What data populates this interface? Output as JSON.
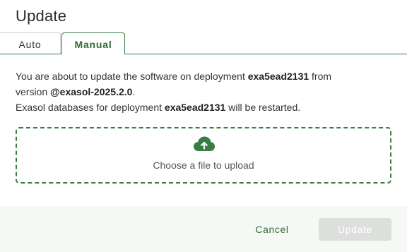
{
  "dialog": {
    "title": "Update"
  },
  "tabs": [
    {
      "label": "Auto",
      "active": false
    },
    {
      "label": "Manual",
      "active": true
    }
  ],
  "message": {
    "line1_pre": "You are about to update the software on deployment ",
    "deployment": "exa5ead2131",
    "line1_post": " from",
    "line2_pre": "version ",
    "version": "@exasol-2025.2.0",
    "line2_post": ".",
    "line3_pre": "Exasol databases for deployment ",
    "deployment_again": "exa5ead2131",
    "line3_post": " will be restarted."
  },
  "dropzone": {
    "icon": "cloud-upload-icon",
    "label": "Choose a file to upload"
  },
  "footer": {
    "cancel_label": "Cancel",
    "update_label": "Update",
    "update_enabled": false
  },
  "colors": {
    "accent": "#3a7d44",
    "accent_text": "#2f6b38",
    "disabled_button": "#dcdfdc",
    "footer_bg": "#f6f8f6"
  }
}
